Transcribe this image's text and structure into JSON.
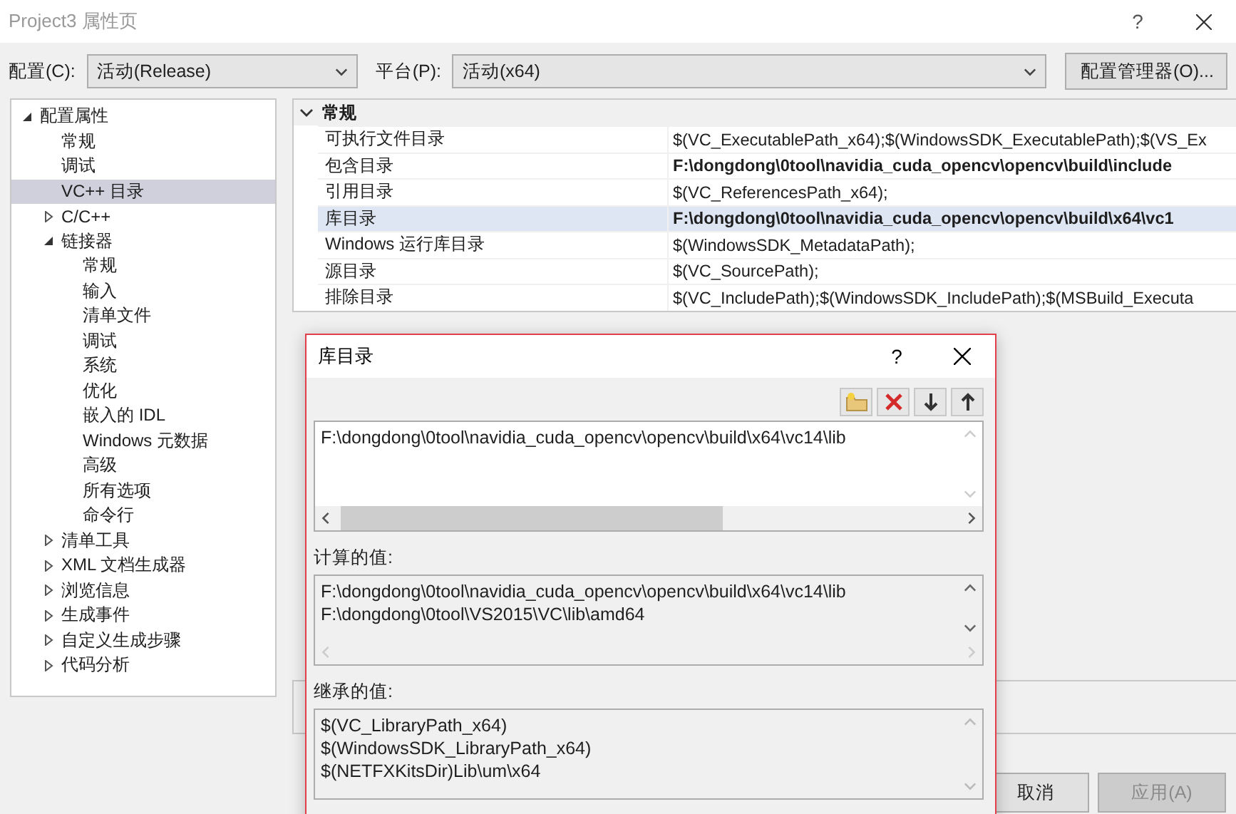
{
  "window": {
    "title": "Project3 属性页",
    "help": "?"
  },
  "config": {
    "label": "配置(C):",
    "value": "活动(Release)"
  },
  "platform": {
    "label": "平台(P):",
    "value": "活动(x64)"
  },
  "config_manager": "配置管理器(O)...",
  "tree": [
    {
      "label": "配置属性",
      "expanded": true,
      "selected": false,
      "children": [
        {
          "label": "常规",
          "selected": false
        },
        {
          "label": "调试",
          "selected": false
        },
        {
          "label": "VC++ 目录",
          "selected": true
        },
        {
          "label": "C/C++",
          "expanded": false,
          "selected": false
        },
        {
          "label": "链接器",
          "expanded": true,
          "selected": false,
          "children": [
            {
              "label": "常规",
              "selected": false
            },
            {
              "label": "输入",
              "selected": false
            },
            {
              "label": "清单文件",
              "selected": false
            },
            {
              "label": "调试",
              "selected": false
            },
            {
              "label": "系统",
              "selected": false
            },
            {
              "label": "优化",
              "selected": false
            },
            {
              "label": "嵌入的 IDL",
              "selected": false
            },
            {
              "label": "Windows 元数据",
              "selected": false
            },
            {
              "label": "高级",
              "selected": false
            },
            {
              "label": "所有选项",
              "selected": false
            },
            {
              "label": "命令行",
              "selected": false
            }
          ]
        },
        {
          "label": "清单工具",
          "expanded": false,
          "selected": false
        },
        {
          "label": "XML 文档生成器",
          "expanded": false,
          "selected": false
        },
        {
          "label": "浏览信息",
          "expanded": false,
          "selected": false
        },
        {
          "label": "生成事件",
          "expanded": false,
          "selected": false
        },
        {
          "label": "自定义生成步骤",
          "expanded": false,
          "selected": false
        },
        {
          "label": "代码分析",
          "expanded": false,
          "selected": false
        }
      ]
    }
  ],
  "grid": {
    "category": {
      "label": "常规",
      "expanded": true
    },
    "rows": [
      {
        "name": "可执行文件目录",
        "value": "$(VC_ExecutablePath_x64);$(WindowsSDK_ExecutablePath);$(VS_Ex",
        "modified": false,
        "selected": false
      },
      {
        "name": "包含目录",
        "value": "F:\\dongdong\\0tool\\navidia_cuda_opencv\\opencv\\build\\include",
        "modified": true,
        "selected": false
      },
      {
        "name": "引用目录",
        "value": "$(VC_ReferencesPath_x64);",
        "modified": false,
        "selected": false
      },
      {
        "name": "库目录",
        "value": "F:\\dongdong\\0tool\\navidia_cuda_opencv\\opencv\\build\\x64\\vc1",
        "modified": true,
        "selected": true
      },
      {
        "name": "Windows 运行库目录",
        "value": "$(WindowsSDK_MetadataPath);",
        "modified": false,
        "selected": false
      },
      {
        "name": "源目录",
        "value": "$(VC_SourcePath);",
        "modified": false,
        "selected": false
      },
      {
        "name": "排除目录",
        "value": "$(VC_IncludePath);$(WindowsSDK_IncludePath);$(MSBuild_Executa",
        "modified": false,
        "selected": false
      }
    ]
  },
  "buttons": [
    {
      "label": "取消",
      "disabled": false
    },
    {
      "label": "应用(A)",
      "disabled": true
    }
  ],
  "dialog": {
    "title": "库目录",
    "help": "?",
    "entries": [
      "F:\\dongdong\\0tool\\navidia_cuda_opencv\\opencv\\build\\x64\\vc14\\lib"
    ],
    "computed_label": "计算的值:",
    "computed": [
      "F:\\dongdong\\0tool\\navidia_cuda_opencv\\opencv\\build\\x64\\vc14\\lib",
      "F:\\dongdong\\0tool\\VS2015\\VC\\lib\\amd64"
    ],
    "inherited_label": "继承的值:",
    "inherited": [
      "$(VC_LibraryPath_x64)",
      "$(WindowsSDK_LibraryPath_x64)",
      "$(NETFXKitsDir)Lib\\um\\x64"
    ]
  }
}
